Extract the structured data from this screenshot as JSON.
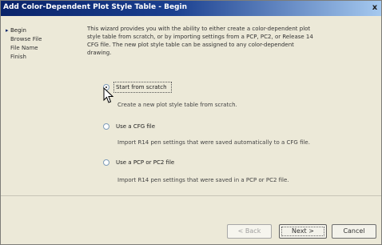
{
  "window": {
    "title": "Add Color-Dependent Plot Style Table - Begin",
    "close_label": "x"
  },
  "steps": [
    {
      "label": "Begin",
      "current": true
    },
    {
      "label": "Browse File",
      "current": false
    },
    {
      "label": "File Name",
      "current": false
    },
    {
      "label": "Finish",
      "current": false
    }
  ],
  "intro_text": "This wizard provides you with the ability to either create a color-dependent plot style table from scratch, or by importing settings from a PCP, PC2, or Release 14 CFG file. The new plot style table can be assigned to any color-dependent drawing.",
  "options": [
    {
      "label": "Start from scratch",
      "selected": true,
      "description": "Create a new plot style table from scratch."
    },
    {
      "label": "Use a CFG file",
      "selected": false,
      "description": "Import R14 pen settings that were saved automatically to a CFG file."
    },
    {
      "label": "Use a PCP or PC2 file",
      "selected": false,
      "description": "Import R14 pen settings that were saved in a PCP or PC2 file."
    }
  ],
  "buttons": {
    "back": "< Back",
    "next": "Next >",
    "cancel": "Cancel"
  }
}
